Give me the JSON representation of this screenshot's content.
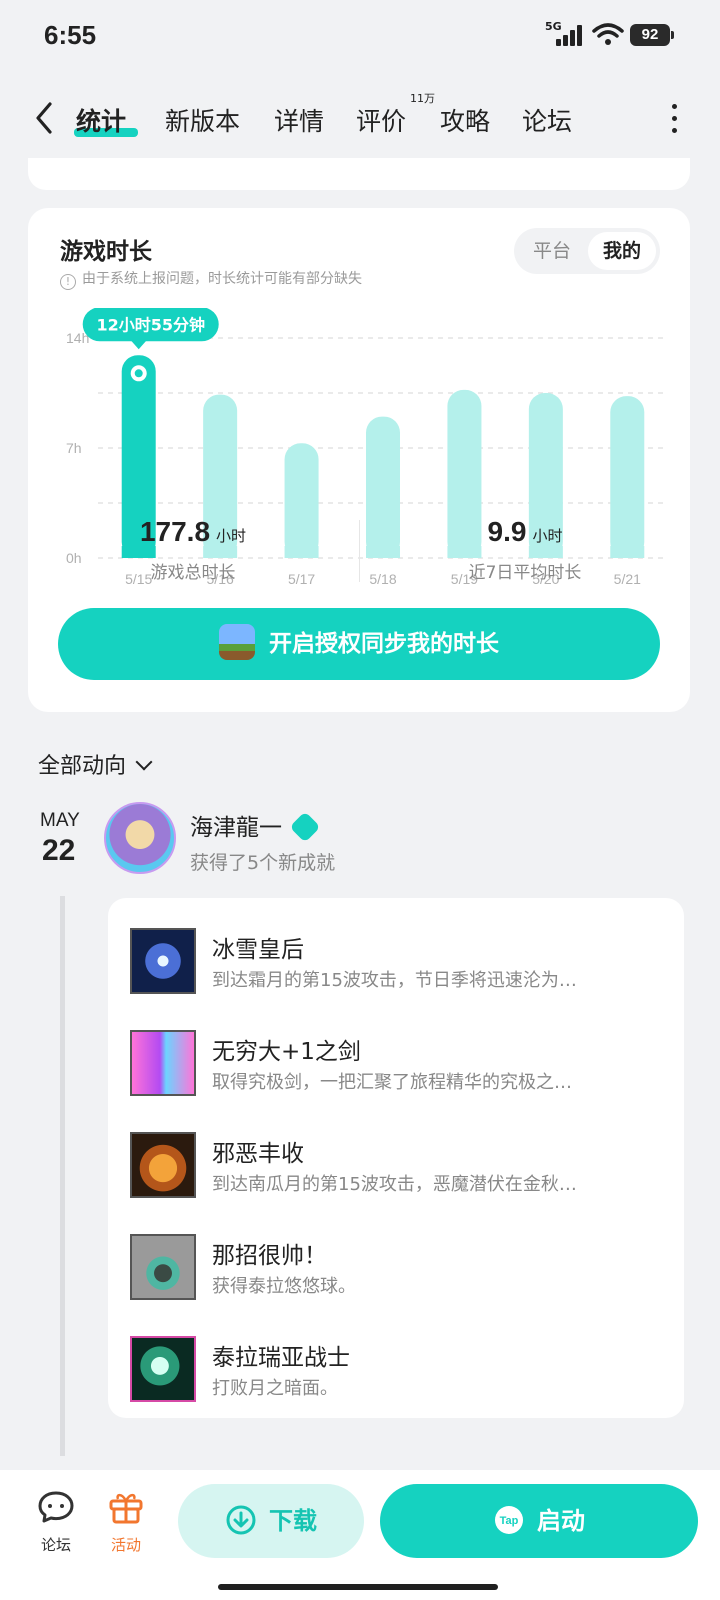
{
  "status": {
    "time": "6:55",
    "network": "5G",
    "battery": "92"
  },
  "nav": {
    "tabs": [
      {
        "label": "统计",
        "active": true
      },
      {
        "label": "新版本"
      },
      {
        "label": "详情"
      },
      {
        "label": "评价",
        "badge": "11万"
      },
      {
        "label": "攻略"
      },
      {
        "label": "论坛"
      }
    ]
  },
  "playtime": {
    "title": "游戏时长",
    "note": "由于系统上报问题，时长统计可能有部分缺失",
    "toggle": [
      "平台",
      "我的"
    ],
    "toggle_active": "我的",
    "tooltip": "12小时55分钟",
    "total_value": "177.8",
    "total_unit": "小时",
    "total_label": "游戏总时长",
    "avg_value": "9.9",
    "avg_unit": "小时",
    "avg_label": "近7日平均时长",
    "sync_button": "开启授权同步我的时长"
  },
  "chart_data": {
    "type": "bar",
    "categories": [
      "5/15",
      "5/16",
      "5/17",
      "5/18",
      "5/19",
      "5/20",
      "5/21"
    ],
    "values": [
      12.9,
      10.4,
      7.3,
      9.0,
      10.7,
      10.5,
      10.3
    ],
    "ylim": [
      0,
      14
    ],
    "yticks": [
      "0h",
      "7h",
      "14h"
    ],
    "highlight_index": 0,
    "colors": {
      "highlight": "#15d2c0",
      "normal": "#b4f0eb"
    }
  },
  "feed": {
    "filter": "全部动向",
    "month": "MAY",
    "day": "22",
    "user": "海津龍一",
    "action": "获得了5个新成就",
    "achievements": [
      {
        "title": "冰雪皇后",
        "desc": "到达霜月的第15波攻击，节日季将迅速沦为…"
      },
      {
        "title": "无穷大+1之剑",
        "desc": "取得究极剑，一把汇聚了旅程精华的究极之…"
      },
      {
        "title": "邪恶丰收",
        "desc": "到达南瓜月的第15波攻击，恶魔潜伏在金秋…"
      },
      {
        "title": "那招很帅！",
        "desc": "获得泰拉悠悠球。"
      },
      {
        "title": "泰拉瑞亚战士",
        "desc": "打败月之暗面。"
      }
    ]
  },
  "bottom": {
    "forum": "论坛",
    "activity": "活动",
    "download": "下载",
    "launch": "启动",
    "tap_icon_text": "Tap"
  }
}
